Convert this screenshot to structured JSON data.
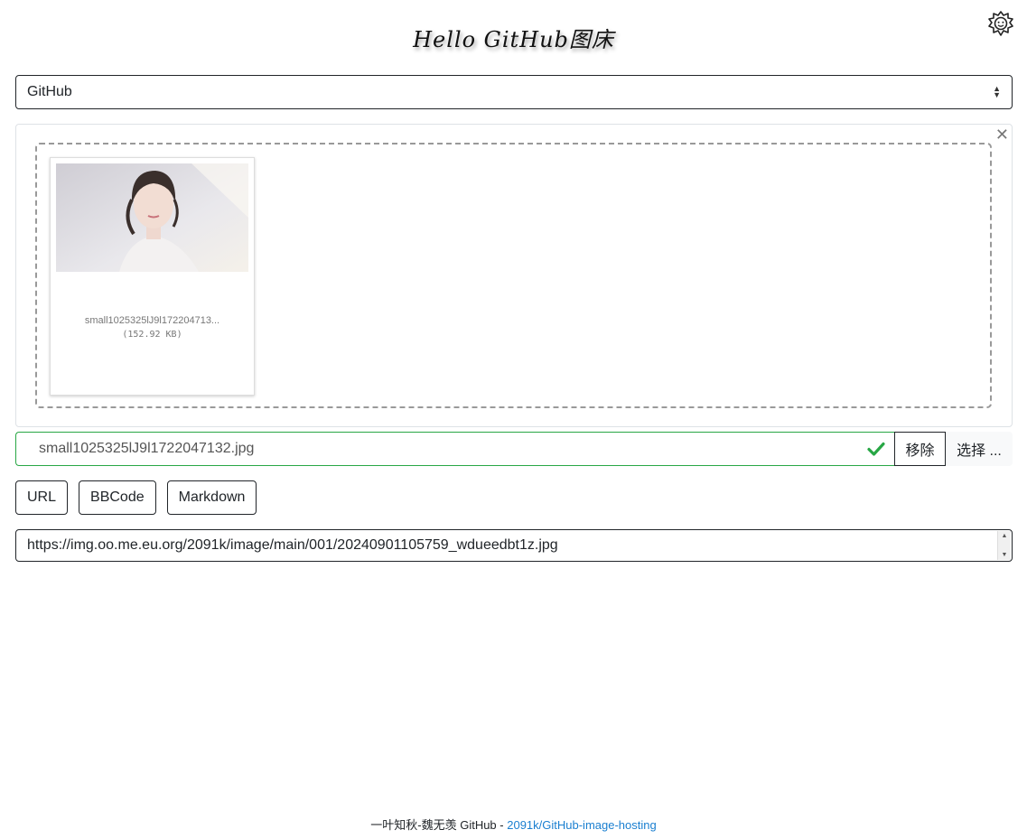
{
  "header": {
    "title": "Hello GitHub图床",
    "theme_icon": "sun-face-icon"
  },
  "storage_select": {
    "value": "GitHub"
  },
  "upload": {
    "close_glyph": "✕",
    "file": {
      "name": "small1025325lJ9l172204713...",
      "size": "(152.92 KB)"
    }
  },
  "file_input": {
    "caption": "small1025325lJ9l1722047132.jpg",
    "status_color": "#28a745",
    "remove_label": "移除",
    "browse_label": "选择 ..."
  },
  "format_buttons": [
    "URL",
    "BBCode",
    "Markdown"
  ],
  "result_link": "https://img.oo.me.eu.org/2091k/image/main/001/20240901105759_wdueedbt1z.jpg",
  "footer": {
    "text": "一叶知秋-魏无羡 GitHub - ",
    "link": "2091k/GitHub-image-hosting"
  }
}
